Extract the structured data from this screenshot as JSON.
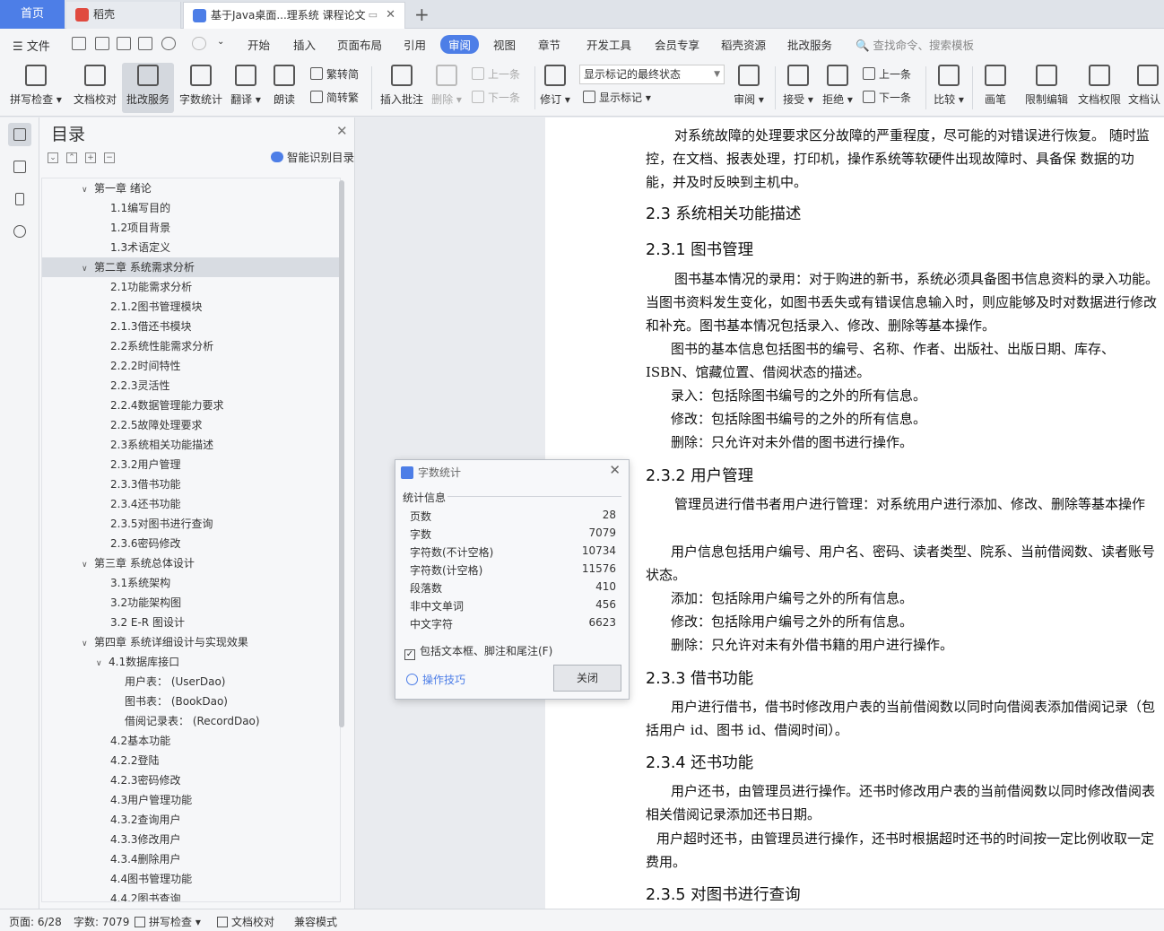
{
  "tabs": {
    "home": "首页",
    "t1": "稻壳",
    "t2": "基于Java桌面...理系统 课程论文"
  },
  "menu": {
    "file": "文件",
    "tabs": [
      "开始",
      "插入",
      "页面布局",
      "引用",
      "审阅",
      "视图",
      "章节",
      "开发工具",
      "会员专享",
      "稻壳资源",
      "批改服务"
    ],
    "active": "审阅",
    "search": "查找命令、搜索模板"
  },
  "ribbon": {
    "spell": "拼写检查",
    "proof": "文档校对",
    "correct": "批改服务",
    "count": "字数统计",
    "translate": "翻译",
    "read": "朗读",
    "t2s": "繁转简",
    "s2t": "简转繁",
    "insert_comment": "插入批注",
    "delete": "删除",
    "prev": "上一条",
    "next": "下一条",
    "revise": "修订",
    "mark_mode": "显示标记的最终状态",
    "show_mark": "显示标记",
    "review": "审阅",
    "accept": "接受",
    "reject": "拒绝",
    "prev2": "上一条",
    "next2": "下一条",
    "compare": "比较",
    "pen": "画笔",
    "restrict": "限制编辑",
    "perm": "文档权限",
    "auth": "文档认"
  },
  "toc": {
    "title": "目录",
    "smart": "智能识别目录",
    "items": [
      {
        "text": "第一章 绪论",
        "level": 1,
        "caret": "∨"
      },
      {
        "text": "1.1编写目的",
        "level": 2
      },
      {
        "text": "1.2项目背景",
        "level": 2
      },
      {
        "text": "1.3术语定义",
        "level": 2
      },
      {
        "text": "第二章 系统需求分析",
        "level": 1,
        "caret": "∨",
        "selected": true
      },
      {
        "text": "2.1功能需求分析",
        "level": 2
      },
      {
        "text": "2.1.2图书管理模块",
        "level": 2
      },
      {
        "text": "2.1.3借还书模块",
        "level": 2
      },
      {
        "text": "2.2系统性能需求分析",
        "level": 2
      },
      {
        "text": "2.2.2时间特性",
        "level": 2
      },
      {
        "text": "2.2.3灵活性",
        "level": 2
      },
      {
        "text": "2.2.4数据管理能力要求",
        "level": 2
      },
      {
        "text": "2.2.5故障处理要求",
        "level": 2
      },
      {
        "text": "2.3系统相关功能描述",
        "level": 2
      },
      {
        "text": "2.3.2用户管理",
        "level": 2
      },
      {
        "text": "2.3.3借书功能",
        "level": 2
      },
      {
        "text": "2.3.4还书功能",
        "level": 2
      },
      {
        "text": "2.3.5对图书进行查询",
        "level": 2
      },
      {
        "text": "2.3.6密码修改",
        "level": 2
      },
      {
        "text": "第三章 系统总体设计",
        "level": 1,
        "caret": "∨"
      },
      {
        "text": "3.1系统架构",
        "level": 2
      },
      {
        "text": "3.2功能架构图",
        "level": 2
      },
      {
        "text": "3.2 E-R 图设计",
        "level": 2
      },
      {
        "text": "第四章 系统详细设计与实现效果",
        "level": 1,
        "caret": "∨"
      },
      {
        "text": "4.1数据库接口",
        "level": 2,
        "caret": "∨"
      },
      {
        "text": "用户表： (UserDao)",
        "level": 3
      },
      {
        "text": "图书表： (BookDao)",
        "level": 3
      },
      {
        "text": "借阅记录表： (RecordDao)",
        "level": 3
      },
      {
        "text": "4.2基本功能",
        "level": 2
      },
      {
        "text": "4.2.2登陆",
        "level": 2
      },
      {
        "text": "4.2.3密码修改",
        "level": 2
      },
      {
        "text": "4.3用户管理功能",
        "level": 2
      },
      {
        "text": "4.3.2查询用户",
        "level": 2
      },
      {
        "text": "4.3.3修改用户",
        "level": 2
      },
      {
        "text": "4.3.4删除用户",
        "level": 2
      },
      {
        "text": "4.4图书管理功能",
        "level": 2
      },
      {
        "text": "4.4.2图书查询",
        "level": 2
      }
    ]
  },
  "doc": {
    "p1": "对系统故障的处理要求区分故障的严重程度，尽可能的对错误进行恢复。 随时监控，在文档、报表处理，打印机，操作系统等软硬件出现故障时、具备保 数据的功能，并及时反映到主机中。",
    "h1": "2.3 系统相关功能描述",
    "h2": "2.3.1 图书管理",
    "p2": "图书基本情况的录用：对于购进的新书，系统必须具备图书信息资料的录入功能。当图书资料发生变化，如图书丢失或有错误信息输入时，则应能够及时对数据进行修改和补充。图书基本情况包括录入、修改、删除等基本操作。",
    "p3": "图书的基本信息包括图书的编号、名称、作者、出版社、出版日期、库存、ISBN、馆藏位置、借阅状态的描述。",
    "p4": "录入：包括除图书编号的之外的所有信息。",
    "p5": "修改：包括除图书编号的之外的所有信息。",
    "p6": "删除：只允许对未外借的图书进行操作。",
    "h3": "2.3.2 用户管理",
    "p7": "管理员进行借书者用户进行管理：对系统用户进行添加、修改、删除等基本操作",
    "p8": "用户信息包括用户编号、用户名、密码、读者类型、院系、当前借阅数、读者账号状态。",
    "p9": "添加：包括除用户编号之外的所有信息。",
    "p10": "修改：包括除用户编号之外的所有信息。",
    "p11": "删除：只允许对未有外借书籍的用户进行操作。",
    "h4": "2.3.3 借书功能",
    "p12": "用户进行借书，借书时修改用户表的当前借阅数以同时向借阅表添加借阅记录（包括用户 id、图书 id、借阅时间）。",
    "h5": "2.3.4 还书功能",
    "p13": "用户还书，由管理员进行操作。还书时修改用户表的当前借阅数以同时修改借阅表相关借阅记录添加还书日期。",
    "p14": "用户超时还书，由管理员进行操作，还书时根据超时还书的时间按一定比例收取一定费用。",
    "h6": "2.3.5 对图书进行查询"
  },
  "dialog": {
    "title": "字数统计",
    "heading": "统计信息",
    "stats": [
      {
        "label": "页数",
        "value": "28"
      },
      {
        "label": "字数",
        "value": "7079"
      },
      {
        "label": "字符数(不计空格)",
        "value": "10734"
      },
      {
        "label": "字符数(计空格)",
        "value": "11576"
      },
      {
        "label": "段落数",
        "value": "410"
      },
      {
        "label": "非中文单词",
        "value": "456"
      },
      {
        "label": "中文字符",
        "value": "6623"
      }
    ],
    "include": "包括文本框、脚注和尾注(F)",
    "tips": "操作技巧",
    "close": "关闭"
  },
  "status": {
    "page": "页面: 6/28",
    "words": "字数: 7079",
    "spell": "拼写检查",
    "proof": "文档校对",
    "compat": "兼容模式"
  },
  "colors": {
    "accent": "#4d7ee7"
  }
}
